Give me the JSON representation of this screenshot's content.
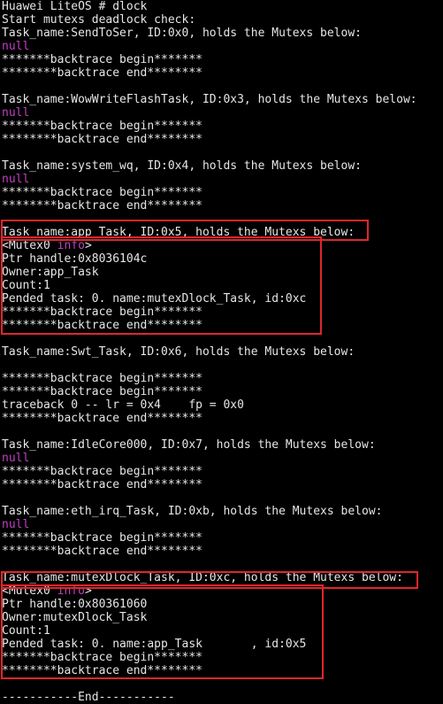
{
  "terminal": {
    "lines": [
      "Huawei LiteOS # dlock",
      "Start mutexs deadlock check:",
      "Task_name:SendToSer, ID:0x0, holds the Mutexs below:",
      "null",
      "*******backtrace begin*******",
      "********backtrace end********",
      "",
      "Task_name:WowWriteFlashTask, ID:0x3, holds the Mutexs below:",
      "null",
      "*******backtrace begin*******",
      "********backtrace end********",
      "",
      "Task_name:system_wq, ID:0x4, holds the Mutexs below:",
      "null",
      "*******backtrace begin*******",
      "********backtrace end********",
      "",
      "Task_name:app_Task, ID:0x5, holds the Mutexs below:",
      "<Mutex0 info>",
      "Ptr handle:0x8036104c",
      "Owner:app_Task",
      "Count:1",
      "Pended task: 0. name:mutexDlock_Task, id:0xc",
      "*******backtrace begin*******",
      "********backtrace end********",
      "",
      "Task_name:Swt_Task, ID:0x6, holds the Mutexs below:",
      "*******backtrace begin*******",
      "*******backtrace begin*******",
      "traceback 0 -- lr = 0x4    fp = 0x0",
      "********backtrace end********",
      "",
      "Task_name:IdleCore000, ID:0x7, holds the Mutexs below:",
      "null",
      "*******backtrace begin*******",
      "********backtrace end********",
      "",
      "Task_name:eth_irq_Task, ID:0xb, holds the Mutexs below:",
      "null",
      "*******backtrace begin*******",
      "********backtrace end********",
      "",
      "Task_name:mutexDlock_Task, ID:0xc, holds the Mutexs below:",
      "<Mutex0 info>",
      "Ptr handle:0x80361060",
      "Owner:mutexDlock_Task",
      "Count:1",
      "Pended task: 0. name:app_Task       , id:0x5",
      "*******backtrace begin*******",
      "********backtrace end********",
      "",
      "-----------End-----------"
    ]
  },
  "colors": {
    "background": "#000000",
    "text": "#e6e6e6",
    "null_text": "#c040c0",
    "highlight_box": "#e0262b"
  }
}
